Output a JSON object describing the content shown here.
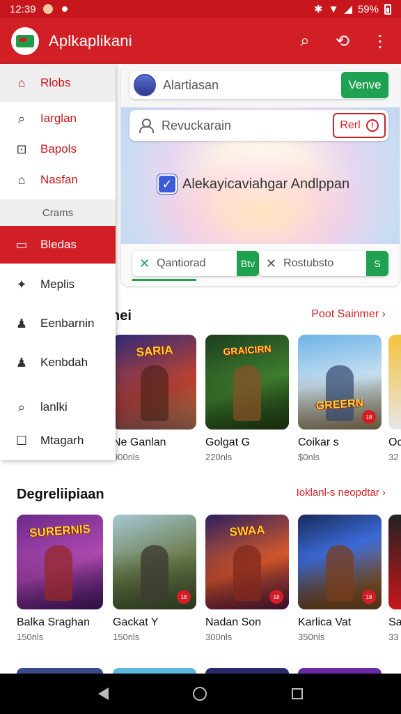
{
  "status": {
    "time": "12:39",
    "battery": "59%"
  },
  "app": {
    "title": "Aplkaplikani"
  },
  "colors": {
    "brand_red": "#d21f26",
    "green": "#1ea150"
  },
  "hero": {
    "account_name": "Alartiasan",
    "verify_label": "Venve",
    "search_text": "Revuckarain",
    "red_button_label": "Rerl",
    "banner_text": "Alekayicaviahgar Andlppan",
    "chip_left": "Qantiorad",
    "chip_left_btn": "Btv",
    "chip_right": "Rostubsto",
    "chip_right_btn": "S"
  },
  "drawer": {
    "home": "Rlobs",
    "items": [
      "Iarglan",
      "Bapols",
      "Nasfan"
    ],
    "category": "Crams",
    "active": "Bledas",
    "items2": [
      "Meplis",
      "Eenbarnin",
      "Kenbdah",
      "lanlki",
      "Mtagarh"
    ]
  },
  "section1": {
    "title_partial": "nei",
    "link": "Poot Sainmer",
    "cards": [
      {
        "name": "Ne Ganlan",
        "meta": "900nls",
        "logo": "SARIA"
      },
      {
        "name": "Golgat G",
        "meta": "220nls",
        "logo": "GRAICIRN"
      },
      {
        "name": "Coikar s",
        "meta": "$0nls",
        "logo": "GREERN"
      },
      {
        "name": "Oc",
        "meta": "32"
      }
    ]
  },
  "section2": {
    "title": "Degreliipiaan",
    "link": "Ioklanl-s neopdtar",
    "cards": [
      {
        "name": "Balka Sraghan",
        "meta": "150nls",
        "logo": "SURERNIS"
      },
      {
        "name": "Gackat Y",
        "meta": "150nls",
        "logo": ""
      },
      {
        "name": "Nadan Son",
        "meta": "300nls",
        "logo": "SWAA"
      },
      {
        "name": "Karlica Vat",
        "meta": "350nls",
        "logo": ""
      },
      {
        "name": "Sa",
        "meta": "33"
      }
    ]
  }
}
